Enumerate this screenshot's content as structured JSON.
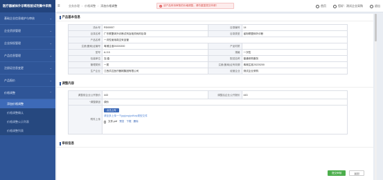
{
  "brand": "医疗器械体外诊断检验试剂集中采购",
  "sidebar": {
    "items": [
      {
        "label": "基础企业信息维护与审核"
      },
      {
        "label": "企业资质管理"
      },
      {
        "label": "企业授权管理"
      },
      {
        "label": "产品信息管理"
      },
      {
        "label": "注册证信息变更"
      },
      {
        "label": "产品报价"
      },
      {
        "label": "价格调整"
      }
    ],
    "submenu": [
      {
        "label": "添加价格调整"
      },
      {
        "label": "价格调整确认"
      },
      {
        "label": "价格调整公示列表"
      },
      {
        "label": "价格调整列表"
      }
    ]
  },
  "topbar": {
    "crumbs": [
      "业务办理",
      "价格调整",
      "添加价格调整"
    ],
    "alert": "该产品有待审核的价格调整，请勿重复提交申请！",
    "home": "首页",
    "user": "您好：测试企业采购",
    "logout": "退出"
  },
  "basic": {
    "title": "产品基本信息",
    "rows": [
      [
        {
          "l": "流水号",
          "v": "RD00007"
        },
        {
          "l": "目录编号",
          "v": "14"
        }
      ],
      [
        {
          "l": "目录名称",
          "v": "广东联盟体外诊断试剂及相关耗材目录"
        },
        {
          "l": "目录类型",
          "v": "省际联盟体外诊断"
        }
      ],
      [
        {
          "l": "产品名称",
          "v": "一次性使用真空采血管"
        }
      ],
      [
        {
          "l": "注册(备案)证编号",
          "v": "粤械注准20220200"
        },
        {
          "l": "产品材质",
          "v": ""
        }
      ],
      [
        {
          "l": "型号",
          "v": "A-3.5"
        },
        {
          "l": "规格",
          "v": "一次性"
        }
      ],
      [
        {
          "l": "包装单位",
          "v": "支/盒"
        },
        {
          "l": "配送名称",
          "v": "普通采购服务"
        }
      ],
      [
        {
          "l": "管理类别",
          "v": "一类"
        },
        {
          "l": "注册(备案)证有效期",
          "v": "粤械注准20220200"
        }
      ],
      [
        {
          "l": "生产企业",
          "v": "江西洪达医疗器械集团有限公司"
        },
        {
          "l": "经营企业",
          "v": "测试企业采购"
        }
      ]
    ]
  },
  "adjust": {
    "title": "调整内容",
    "new_price_label": "调整前企业公开报价",
    "new_price_value": "443",
    "old_price_label": "调整后企业公开报价",
    "old_price_value": "443",
    "reason_label": "*调整原因",
    "reason_value": "调价",
    "attach_label": "附件上传",
    "upload_button": "点击上传",
    "hint": "请至多上传一个jpg/png/pdf/zip类型文件",
    "file_name": "文件.pdf",
    "file_actions": [
      "预览",
      "下载",
      "删除"
    ]
  },
  "next_section": "审核信息",
  "buttons": {
    "submit": "提交审核",
    "back": "返回"
  }
}
